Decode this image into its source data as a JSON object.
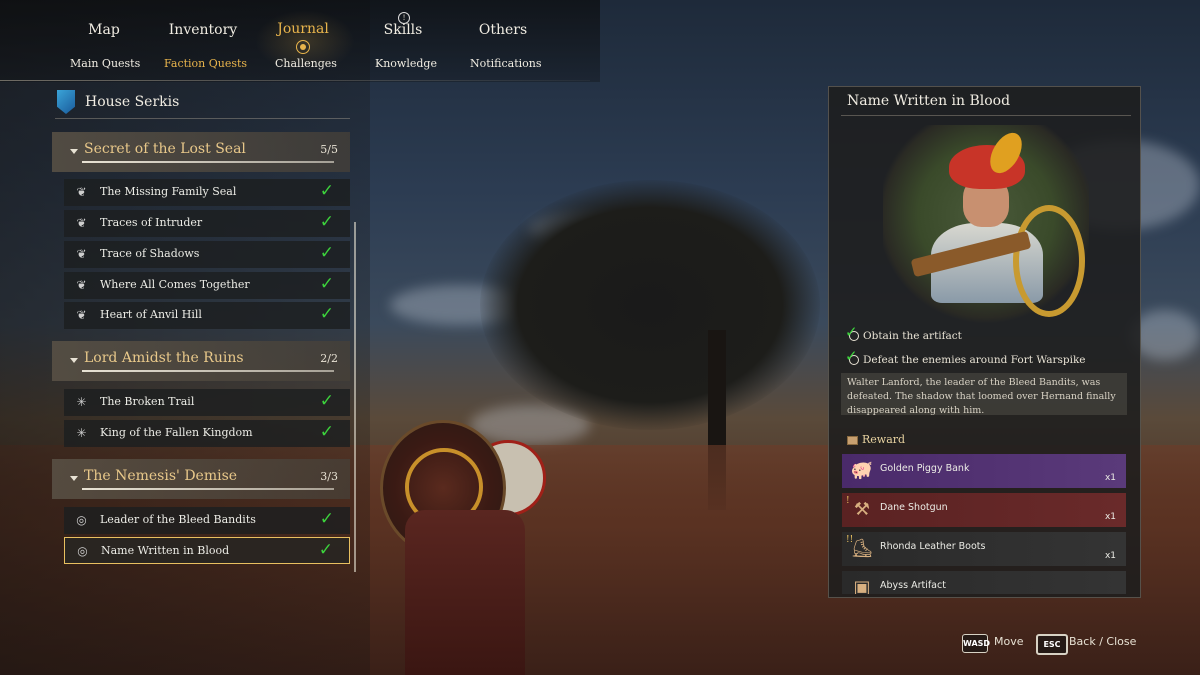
{
  "nav": {
    "tabs": [
      "Map",
      "Inventory",
      "Journal",
      "Skills",
      "Others"
    ],
    "active_tab": "Journal",
    "skills_badge": "",
    "subtabs": [
      "Main Quests",
      "Faction Quests",
      "Challenges",
      "Knowledge",
      "Notifications"
    ],
    "active_subtab": "Faction Quests"
  },
  "faction": {
    "name": "House Serkis",
    "icon": "faction-crest-icon"
  },
  "groups": [
    {
      "title": "Secret of the Lost Seal",
      "count": "5/5",
      "quests": [
        {
          "label": "The Missing Family Seal",
          "icon": "bird-crest-icon",
          "done": "✓"
        },
        {
          "label": "Traces of Intruder",
          "icon": "bird-crest-icon",
          "done": "✓"
        },
        {
          "label": "Trace of Shadows",
          "icon": "bird-crest-icon",
          "done": "✓"
        },
        {
          "label": "Where All Comes Together",
          "icon": "bird-crest-icon",
          "done": "✓"
        },
        {
          "label": "Heart of Anvil Hill",
          "icon": "bird-crest-icon",
          "done": "✓"
        }
      ]
    },
    {
      "title": "Lord Amidst the Ruins",
      "count": "2/2",
      "quests": [
        {
          "label": "The Broken Trail",
          "icon": "sun-crest-icon",
          "done": "✓"
        },
        {
          "label": "King of the Fallen Kingdom",
          "icon": "sun-crest-icon",
          "done": "✓"
        }
      ]
    },
    {
      "title": "The Nemesis' Demise",
      "count": "3/3",
      "quests": [
        {
          "label": "Leader of the Bleed Bandits",
          "icon": "ring-crest-icon",
          "done": "✓"
        },
        {
          "label": "Name Written in Blood",
          "icon": "ring-crest-icon",
          "done": "✓"
        }
      ]
    }
  ],
  "detail": {
    "title": "Name Written in Blood",
    "objectives": [
      {
        "text": "Obtain the artifact",
        "done": "✓"
      },
      {
        "text": "Defeat the enemies around Fort Warspike",
        "done": "✓"
      }
    ],
    "description": "Walter Lanford, the leader of the Bleed Bandits, was defeated. The shadow that loomed over Hernand finally disappeared along with him.",
    "reward_title": "Reward",
    "rewards": [
      {
        "name": "Golden Piggy Bank",
        "qty": "x1",
        "rarity": "purple",
        "icon": "piggy-bank-icon"
      },
      {
        "name": "Dane Shotgun",
        "qty": "x1",
        "rarity": "red",
        "icon": "shotgun-icon"
      },
      {
        "name": "Rhonda Leather Boots",
        "qty": "x1",
        "rarity": "gray",
        "icon": "boots-icon"
      },
      {
        "name": "Abyss Artifact",
        "qty": "",
        "rarity": "gray",
        "icon": "artifact-icon"
      }
    ]
  },
  "hints": {
    "move_key": "WASD",
    "move_label": "Move",
    "back_key": "ESC",
    "back_label": "Back / Close"
  },
  "colors": {
    "accent": "#e8b44c",
    "check": "#3cd23c",
    "selected_border": "#e8c060",
    "purple_reward": "#4a2a6a",
    "red_reward": "#5a2222"
  }
}
